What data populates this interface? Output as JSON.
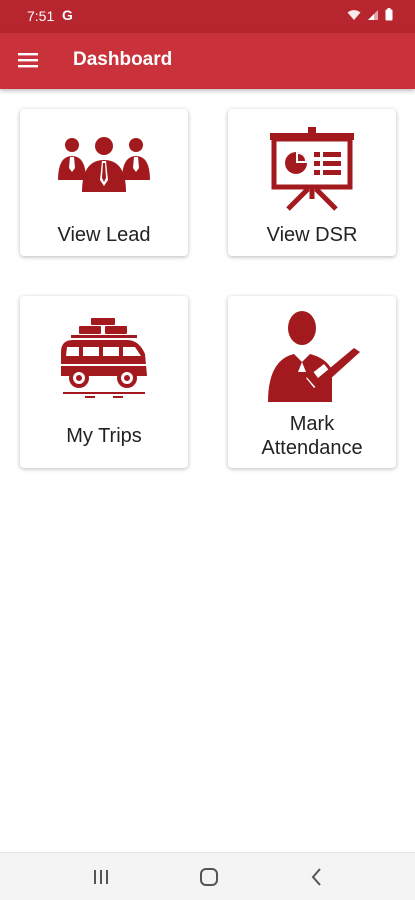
{
  "status_bar": {
    "time": "7:51",
    "google_icon": "G"
  },
  "app_bar": {
    "title": "Dashboard",
    "menu_icon": "hamburger-menu-icon"
  },
  "tiles": [
    {
      "label": "View Lead",
      "icon": "team-leads-icon"
    },
    {
      "label": "View DSR",
      "icon": "presentation-board-icon"
    },
    {
      "label": "My Trips",
      "icon": "van-with-luggage-icon"
    },
    {
      "label_line1": "Mark",
      "label_line2": "Attendance",
      "icon": "person-checkmark-icon"
    }
  ],
  "colors": {
    "status_bar": "#b7262e",
    "app_bar": "#c9323a",
    "icon": "#a31a1e"
  }
}
